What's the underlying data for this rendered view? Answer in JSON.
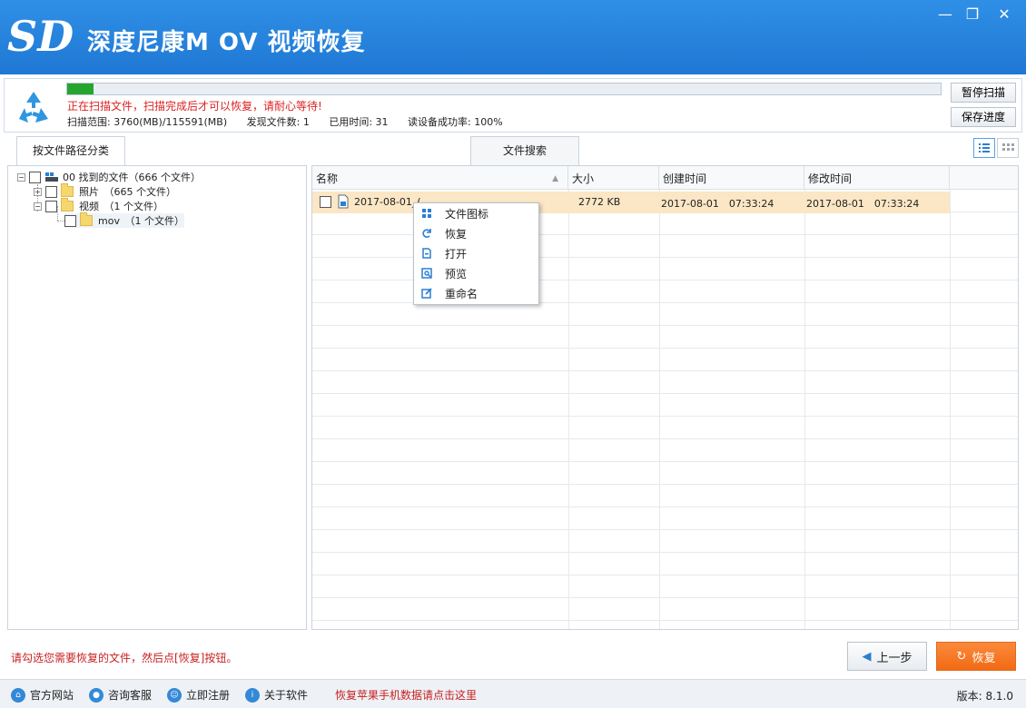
{
  "app": {
    "title": "深度尼康M OV 视频恢复",
    "brand_color": "#2583dc"
  },
  "window_controls": {
    "minimize": "—",
    "restore": "❐",
    "close": "✕"
  },
  "scan": {
    "progress_fraction": 0.03,
    "status": "正在扫描文件，扫描完成后才可以恢复，请耐心等待!",
    "range": "扫描范围: 3760(MB)/115591(MB)",
    "found": "发现文件数: 1",
    "elapsed": "已用时间: 31",
    "success_rate": "读设备成功率: 100%",
    "pause_label": "暂停扫描",
    "save_label": "保存进度"
  },
  "tabs": {
    "path": "按文件路径分类",
    "search": "文件搜索"
  },
  "tree": {
    "root": "00 找到的文件（666 个文件）",
    "photos": "照片　（665 个文件）",
    "videos": "视频　（1 个文件）",
    "mov": "mov　（1 个文件）"
  },
  "list": {
    "columns": {
      "name": "名称",
      "size": "大小",
      "created": "创建时间",
      "modified": "修改时间"
    },
    "rows": [
      {
        "name": "2017-08-01_(",
        "size": "2772 KB",
        "created": "2017-08-01　07:33:24",
        "modified": "2017-08-01　07:33:24"
      }
    ]
  },
  "context_menu": {
    "items": [
      {
        "label": "文件图标",
        "icon": "grid-icon"
      },
      {
        "label": "恢复",
        "icon": "refresh-icon"
      },
      {
        "label": "打开",
        "icon": "file-icon"
      },
      {
        "label": "预览",
        "icon": "preview-icon"
      },
      {
        "label": "重命名",
        "icon": "edit-icon"
      }
    ]
  },
  "bottom": {
    "hint": "请勾选您需要恢复的文件，然后点[恢复]按钮。",
    "back_label": "上一步",
    "recover_label": "恢复"
  },
  "footer": {
    "website": "官方网站",
    "support": "咨询客服",
    "register": "立即注册",
    "about": "关于软件",
    "apple_link": "恢复苹果手机数据请点击这里",
    "version": "版本: 8.1.0"
  }
}
